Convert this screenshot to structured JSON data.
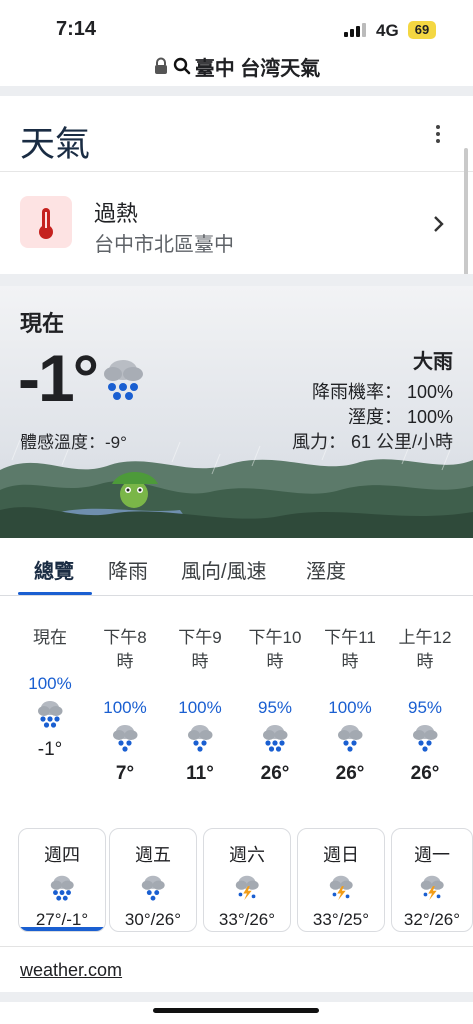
{
  "status": {
    "time": "7:14",
    "network": "4G",
    "battery": "69"
  },
  "address": {
    "query": "臺中 台湾天氣"
  },
  "header": {
    "title": "天氣"
  },
  "alert": {
    "title": "過熱",
    "location": "台中市北區臺中"
  },
  "current": {
    "label": "現在",
    "temp": "-1°",
    "feels_like": "體感溫度：-9°",
    "condition": "大雨",
    "precip": "降雨機率： 100%",
    "humidity": "溼度： 100%",
    "wind": "風力： 61 公里/小時"
  },
  "tabs": [
    "總覽",
    "降雨",
    "風向/風速",
    "溼度"
  ],
  "hourly": [
    {
      "label": "現在",
      "precip": "100%",
      "temp": "-1°",
      "icon": "heavy-rain-icon"
    },
    {
      "label": "下午8時",
      "precip": "100%",
      "temp": "7°",
      "icon": "rain-icon"
    },
    {
      "label": "下午9時",
      "precip": "100%",
      "temp": "11°",
      "icon": "rain-icon"
    },
    {
      "label": "下午10時",
      "precip": "95%",
      "temp": "26°",
      "icon": "heavy-rain-icon"
    },
    {
      "label": "下午11時",
      "precip": "100%",
      "temp": "26°",
      "icon": "rain-icon"
    },
    {
      "label": "上午12時",
      "precip": "95%",
      "temp": "26°",
      "icon": "rain-icon"
    }
  ],
  "daily": [
    {
      "name": "週四",
      "range": "27°/-1°",
      "icon": "heavy-rain-icon"
    },
    {
      "name": "週五",
      "range": "30°/26°",
      "icon": "rain-icon"
    },
    {
      "name": "週六",
      "range": "33°/26°",
      "icon": "thunderstorm-icon"
    },
    {
      "name": "週日",
      "range": "33°/25°",
      "icon": "thunderstorm-icon"
    },
    {
      "name": "週一",
      "range": "32°/26°",
      "icon": "thunderstorm-icon"
    }
  ],
  "source": "weather.com",
  "colors": {
    "accent": "#1a5fd1",
    "title": "#1a2c43",
    "alert_bg": "#fde3e3",
    "thermometer": "#c5221f"
  }
}
